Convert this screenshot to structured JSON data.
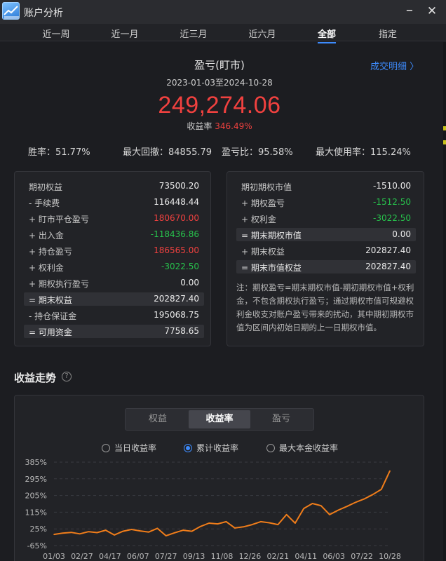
{
  "window": {
    "title": "账户分析",
    "minimize": "−",
    "close": "✕"
  },
  "tabs": [
    {
      "label": "近一周"
    },
    {
      "label": "近一月"
    },
    {
      "label": "近三月"
    },
    {
      "label": "近六月"
    },
    {
      "label": "全部",
      "active": true
    },
    {
      "label": "指定"
    }
  ],
  "summary": {
    "title": "盈亏(盯市)",
    "detail_link": "成交明细 〉",
    "date_range": "2023-01-03至2024-10-28",
    "value": "249,274.06",
    "rate_label": "收益率 ",
    "rate_value": "346.49%"
  },
  "stats": {
    "win_rate": "胜率：51.77%",
    "max_drawdown": "最大回撤：84855.79",
    "profit_loss_ratio": "盈亏比：95.58%",
    "max_usage": "最大使用率：115.24%"
  },
  "left_card": [
    {
      "label": "期初权益",
      "value": "73500.20",
      "color": "normal",
      "highlight": false
    },
    {
      "label": "- 手续费",
      "value": "116448.44",
      "color": "normal",
      "highlight": false
    },
    {
      "label": "+ 盯市平仓盈亏",
      "value": "180670.00",
      "color": "red",
      "highlight": false
    },
    {
      "label": "+ 出入金",
      "value": "-118436.86",
      "color": "green",
      "highlight": false
    },
    {
      "label": "+ 持仓盈亏",
      "value": "186565.00",
      "color": "red",
      "highlight": false
    },
    {
      "label": "+ 权利金",
      "value": "-3022.50",
      "color": "green",
      "highlight": false
    },
    {
      "label": "+ 期权执行盈亏",
      "value": "0.00",
      "color": "normal",
      "highlight": false
    },
    {
      "label": "= 期末权益",
      "value": "202827.40",
      "color": "normal",
      "highlight": true
    },
    {
      "label": "- 持仓保证金",
      "value": "195068.75",
      "color": "normal",
      "highlight": false
    },
    {
      "label": "= 可用资金",
      "value": "7758.65",
      "color": "normal",
      "highlight": true
    }
  ],
  "right_card": [
    {
      "label": "期初期权市值",
      "value": "-1510.00",
      "color": "normal",
      "highlight": false
    },
    {
      "label": "+ 期权盈亏",
      "value": "-1512.50",
      "color": "green",
      "highlight": false
    },
    {
      "label": "+ 权利金",
      "value": "-3022.50",
      "color": "green",
      "highlight": false
    },
    {
      "label": "= 期末期权市值",
      "value": "0.00",
      "color": "normal",
      "highlight": true
    },
    {
      "label": "+ 期末权益",
      "value": "202827.40",
      "color": "normal",
      "highlight": false
    },
    {
      "label": "= 期末市值权益",
      "value": "202827.40",
      "color": "normal",
      "highlight": true
    }
  ],
  "right_note": "注：期权盈亏=期末期权市值-期初期权市值+权利金，不包含期权执行盈亏；通过期权市值可规避权利金收支对账户盈亏带来的扰动，其中期初期权市值为区间内初始日期的上一日期权市值。",
  "trend": {
    "section_title": "收益走势",
    "help_icon": "?",
    "segments": [
      {
        "label": "权益"
      },
      {
        "label": "收益率",
        "active": true
      },
      {
        "label": "盈亏"
      }
    ],
    "radios": [
      {
        "label": "当日收益率",
        "checked": false
      },
      {
        "label": "累计收益率",
        "checked": true
      },
      {
        "label": "最大本金收益率",
        "checked": false
      }
    ]
  },
  "colors": {
    "line": "#f07d1a",
    "accent": "#3d8bfd",
    "positive": "#f0413f",
    "negative": "#27c24c"
  },
  "chart_data": {
    "type": "line",
    "ylabel": "",
    "xlabel": "",
    "y_ticks": [
      "385%",
      "295%",
      "205%",
      "115%",
      "25%",
      "-65%"
    ],
    "y_tick_values": [
      385,
      295,
      205,
      115,
      25,
      -65
    ],
    "ylim": [
      -65,
      385
    ],
    "x_ticks": [
      "01/03",
      "02/27",
      "04/17",
      "06/07",
      "07/27",
      "09/13",
      "11/08",
      "12/26",
      "02/21",
      "04/11",
      "06/03",
      "07/22",
      "10/28"
    ],
    "grid": true,
    "series": [
      {
        "name": "累计收益率",
        "x": [
          "01/03",
          "01/20",
          "02/06",
          "02/27",
          "03/15",
          "04/03",
          "04/17",
          "05/05",
          "05/22",
          "06/07",
          "06/25",
          "07/10",
          "07/27",
          "08/11",
          "08/28",
          "09/13",
          "10/05",
          "10/20",
          "11/08",
          "11/25",
          "12/10",
          "12/26",
          "01/10",
          "01/30",
          "02/21",
          "03/08",
          "03/25",
          "04/11",
          "04/25",
          "05/14",
          "06/03",
          "06/18",
          "07/05",
          "07/22",
          "08/08",
          "08/26",
          "09/12",
          "09/26",
          "10/14",
          "10/28"
        ],
        "values": [
          -5,
          2,
          6,
          -2,
          10,
          5,
          18,
          -8,
          12,
          22,
          14,
          8,
          28,
          -12,
          4,
          18,
          12,
          38,
          56,
          52,
          64,
          30,
          36,
          48,
          64,
          58,
          48,
          102,
          56,
          135,
          162,
          150,
          102,
          126,
          146,
          168,
          186,
          210,
          238,
          338
        ]
      }
    ]
  }
}
